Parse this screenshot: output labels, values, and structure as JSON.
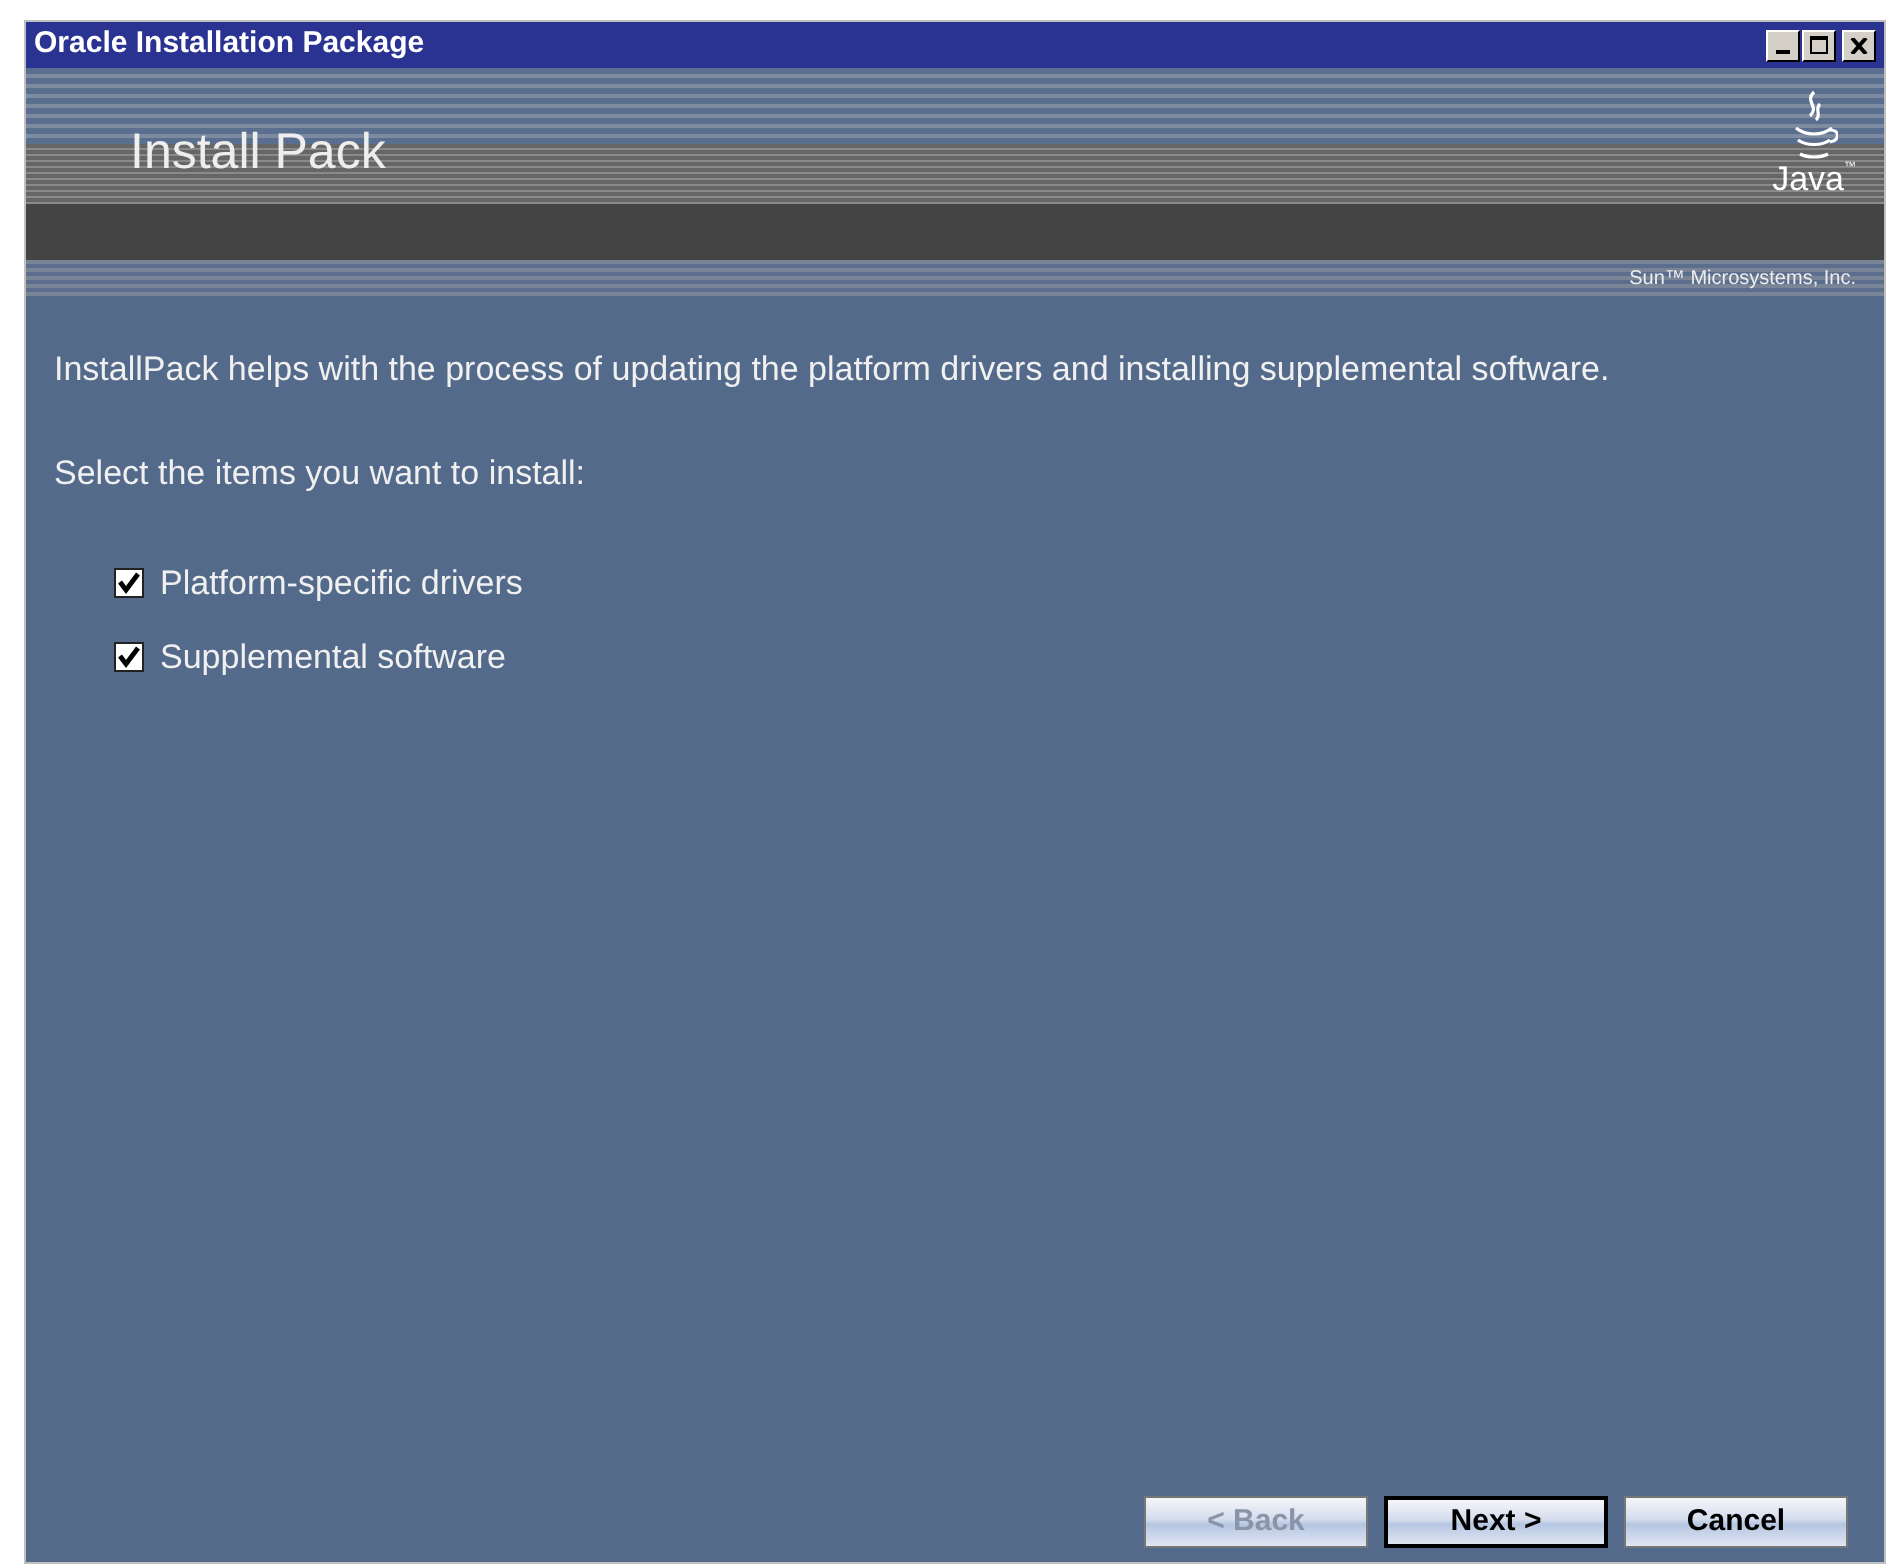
{
  "window": {
    "title": "Oracle Installation Package"
  },
  "banner": {
    "title": "Install Pack",
    "logo_text": "Java",
    "logo_mark": "™",
    "vendor": "Sun™ Microsystems, Inc."
  },
  "intro": "InstallPack helps with the process of updating the platform drivers and installing supplemental software.",
  "prompt": "Select the items you want to install:",
  "items": [
    {
      "label": "Platform-specific drivers",
      "checked": true
    },
    {
      "label": "Supplemental software",
      "checked": true
    }
  ],
  "buttons": [
    {
      "label": "< Back",
      "disabled": true,
      "default": false
    },
    {
      "label": "Next >",
      "disabled": false,
      "default": true
    },
    {
      "label": "Cancel",
      "disabled": false,
      "default": false
    }
  ]
}
